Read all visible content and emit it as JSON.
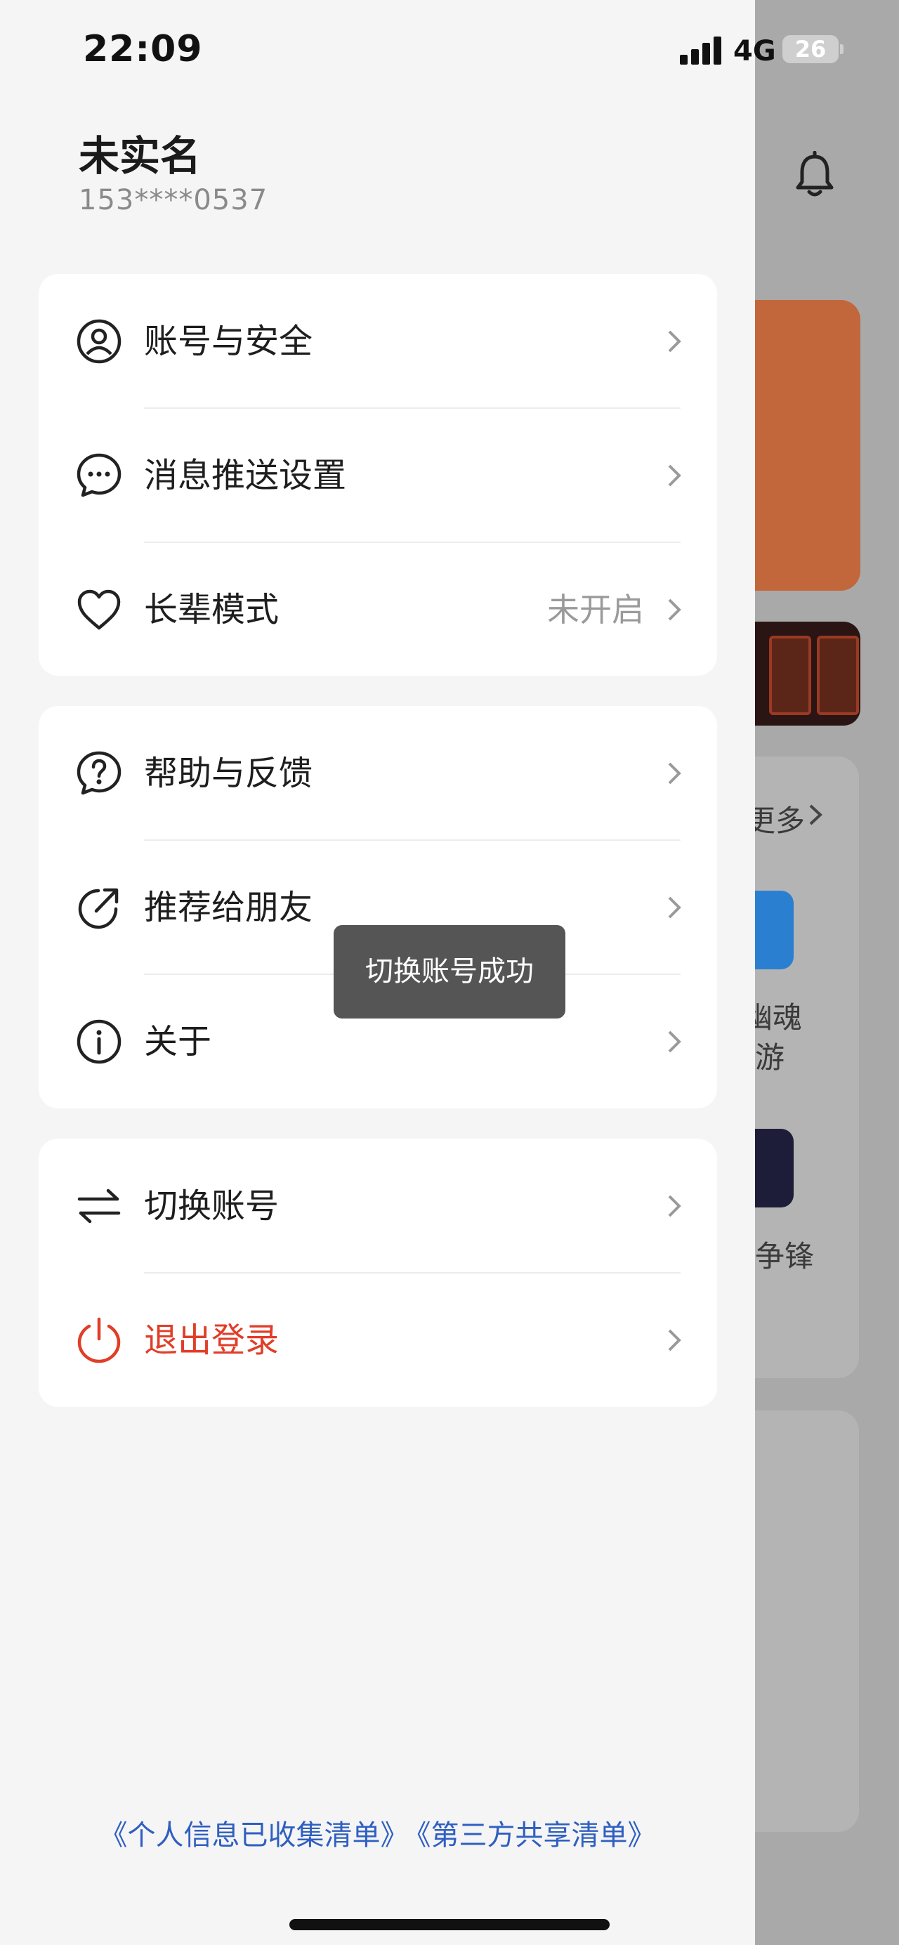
{
  "status_bar": {
    "time": "22:09",
    "network": "4G",
    "battery": "26"
  },
  "user": {
    "name": "未实名",
    "phone": "153****0537"
  },
  "menu": {
    "group1": [
      {
        "label": "账号与安全",
        "icon": "user-circle-icon"
      },
      {
        "label": "消息推送设置",
        "icon": "chat-bubble-icon"
      },
      {
        "label": "长辈模式",
        "icon": "heart-icon",
        "value": "未开启"
      }
    ],
    "group2": [
      {
        "label": "帮助与反馈",
        "icon": "help-circle-icon"
      },
      {
        "label": "推荐给朋友",
        "icon": "share-icon"
      },
      {
        "label": "关于",
        "icon": "info-icon"
      }
    ],
    "group3": [
      {
        "label": "切换账号",
        "icon": "switch-arrows-icon"
      },
      {
        "label": "退出登录",
        "icon": "power-icon"
      }
    ]
  },
  "toast": "切换账号成功",
  "footer": {
    "link1": "《个人信息已收集清单》",
    "link2": "《第三方共享清单》"
  },
  "background": {
    "more": "更多",
    "game1": "幽魂",
    "game1_line2": "游",
    "game2": "争锋"
  },
  "colors": {
    "danger": "#e03e28",
    "link": "#2f5fc0",
    "overlay": "#a9a9a9"
  }
}
